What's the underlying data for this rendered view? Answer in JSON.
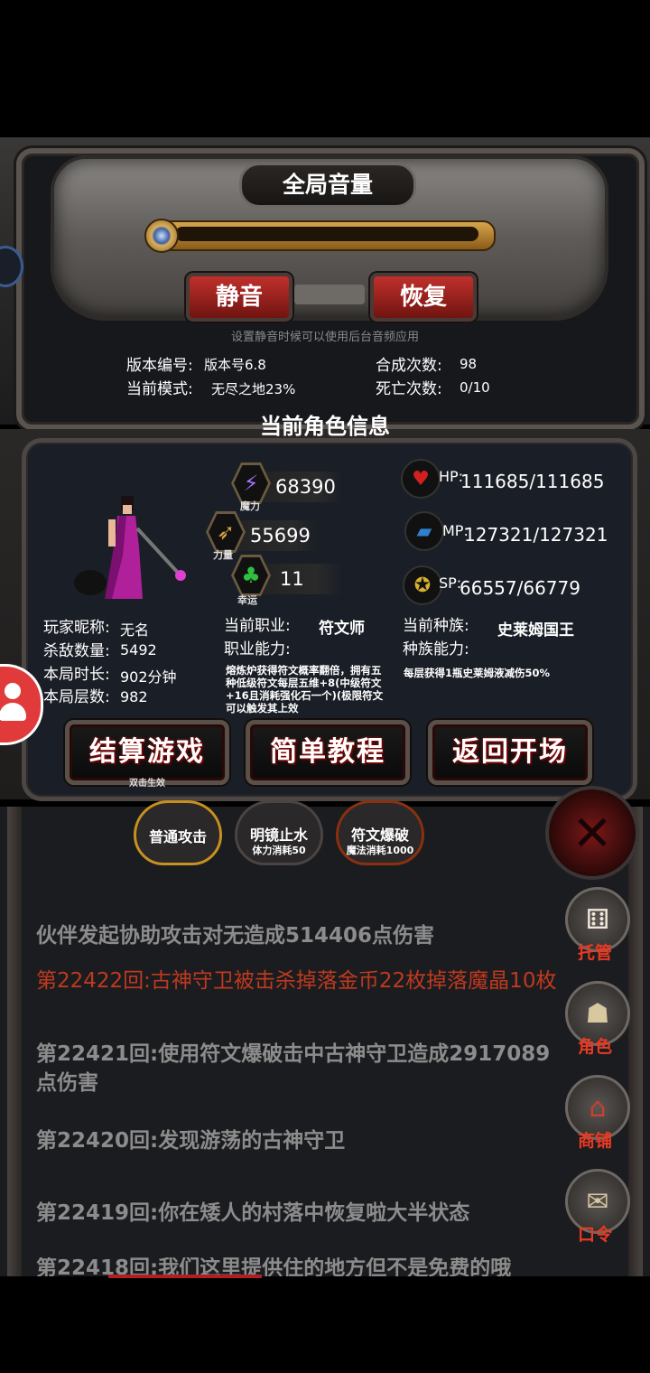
{
  "settings": {
    "volume_title": "全局音量",
    "volume_level": 1.0,
    "mute_label": "静音",
    "restore_label": "恢复",
    "hint": "设置静音时候可以使用后台音频应用",
    "version_label": "版本编号:",
    "version_value": "版本号6.8",
    "mode_label": "当前模式:",
    "mode_value": "无尽之地23%",
    "synth_label": "合成次数:",
    "synth_value": "98",
    "death_label": "死亡次数:",
    "death_value": "0/10"
  },
  "character": {
    "section_title": "当前角色信息",
    "magic_value": "68390",
    "magic_label": "魔力",
    "power_value": "55699",
    "power_label": "力量",
    "luck_value": "11",
    "luck_label": "幸运",
    "hp_label": "HP:",
    "hp_value": "111685/111685",
    "mp_label": "MP:",
    "mp_value": "127321/127321",
    "sp_label": "SP:",
    "sp_value": "66557/66779",
    "nickname_label": "玩家昵称:",
    "nickname_value": "无名",
    "kills_label": "杀敌数量:",
    "kills_value": "5492",
    "duration_label": "本局时长:",
    "duration_value": "902分钟",
    "floors_label": "本局层数:",
    "floors_value": "982",
    "job_label": "当前职业:",
    "job_value": "符文师",
    "job_ability_label": "职业能力:",
    "job_ability_desc": "熔炼炉获得符文概率翻倍，拥有五种低级符文每层五维+8(中级符文+16且消耗强化石一个)(极限符文可以触发其上效",
    "race_label": "当前种族:",
    "race_value": "史莱姆国王",
    "race_ability_label": "种族能力:",
    "race_ability_desc": "每层获得1瓶史莱姆液减伤50%"
  },
  "actions": {
    "settle_label": "结算游戏",
    "settle_hint": "双击生效",
    "tutorial_label": "简单教程",
    "return_label": "返回开场"
  },
  "skills": [
    {
      "name": "普通攻击",
      "cost": ""
    },
    {
      "name": "明镜止水",
      "cost": "体力消耗50"
    },
    {
      "name": "符文爆破",
      "cost": "魔法消耗1000"
    }
  ],
  "log": [
    {
      "text": "伙伴发起协助攻击对无造成514406点伤害",
      "color": "#ffffff"
    },
    {
      "text": "第22422回:古神守卫被击杀掉落金币22枚掉落魔晶10枚",
      "color": "#c0391f"
    },
    {
      "text": "第22421回:使用符文爆破击中古神守卫造成2917089点伤害",
      "color": "#8c8c8c"
    },
    {
      "text": "第22420回:发现游荡的古神守卫",
      "color": "#8c8c8c"
    },
    {
      "text": "第22419回:你在矮人的村落中恢复啦大半状态",
      "color": "#8c8c8c"
    },
    {
      "text": "第22418回:我们这里提供住的地方但不是免费的哦",
      "color": "#8c8c8c"
    }
  ],
  "side": {
    "auto_label": "托管",
    "role_label": "角色",
    "shop_label": "商铺",
    "code_label": "口令"
  },
  "colors": {
    "accent_red": "#e83a24",
    "button_red": "#c0302c",
    "log_highlight": "#c0391f"
  }
}
